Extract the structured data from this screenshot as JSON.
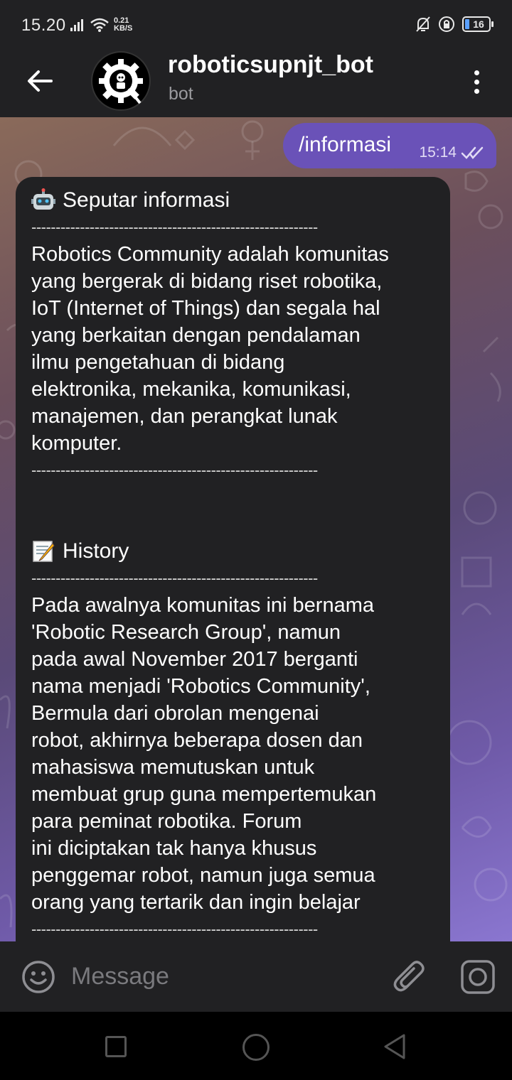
{
  "status_bar": {
    "time": "15.20",
    "net_speed_value": "0.21",
    "net_speed_unit": "KB/S",
    "battery": "16"
  },
  "header": {
    "title": "roboticsupnjt_bot",
    "subtitle": "bot",
    "avatar_text": "ROBOTICS COMMUNITY"
  },
  "outgoing": {
    "text": "/informasi",
    "time": "15:14"
  },
  "incoming": {
    "heading_1": "Seputar informasi",
    "separator": "-----------------------------------------------------------",
    "para_1": [
      "Robotics Community adalah komunitas",
      "yang bergerak di bidang riset robotika,",
      "IoT (Internet of Things) dan segala hal",
      "yang berkaitan dengan pendalaman",
      "ilmu pengetahuan di bidang",
      "elektronika, mekanika, komunikasi,",
      "manajemen, dan perangkat lunak",
      "komputer."
    ],
    "heading_2": "History",
    "para_2": [
      "Pada awalnya komunitas ini bernama",
      "'Robotic Research Group', namun",
      "pada awal November 2017 berganti",
      "nama menjadi 'Robotics Community',",
      "Bermula dari obrolan mengenai",
      "robot, akhirnya beberapa dosen dan",
      "mahasiswa memutuskan untuk",
      "membuat grup guna mempertemukan",
      "para peminat robotika. Forum",
      "ini diciptakan tak hanya khusus",
      "penggemar robot, namun juga semua",
      "orang yang tertarik dan ingin belajar"
    ]
  },
  "input": {
    "placeholder": "Message"
  },
  "icons": {
    "back": "arrow-left-icon",
    "menu": "more-vertical-icon",
    "emoji": "smiley-icon",
    "attach": "paperclip-icon",
    "camera": "camera-icon",
    "robot": "robot-face-icon",
    "memo": "memo-icon"
  },
  "colors": {
    "header_bg": "#212123",
    "outgoing_bubble": "#6a52b8",
    "incoming_bubble": "#212123"
  }
}
